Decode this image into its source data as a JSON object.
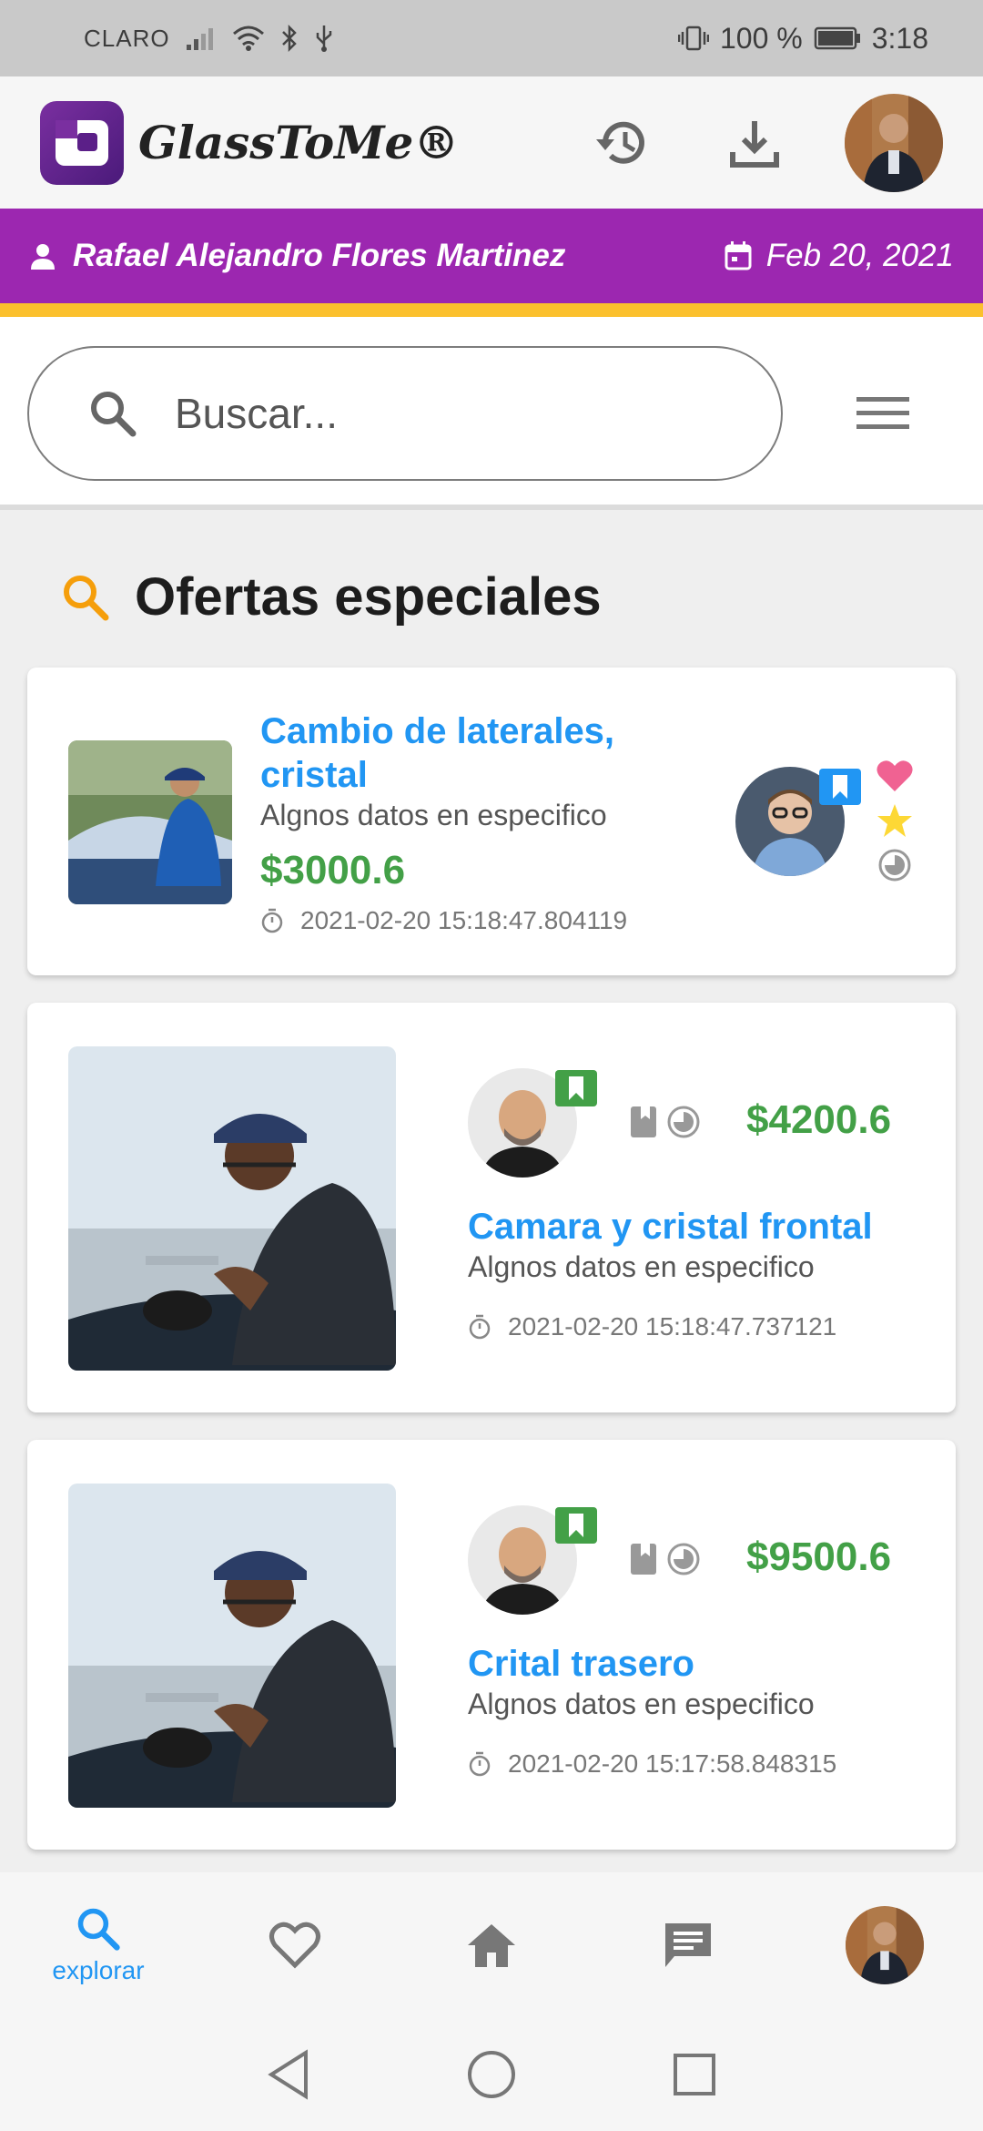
{
  "status_bar": {
    "carrier": "CLARO",
    "battery": "100 %",
    "time": "3:18"
  },
  "app": {
    "name": "GlassToMe®"
  },
  "user_bar": {
    "name": "Rafael Alejandro Flores Martinez",
    "date": "Feb 20, 2021"
  },
  "search": {
    "placeholder": "Buscar..."
  },
  "section": {
    "title": "Ofertas especiales"
  },
  "offers": [
    {
      "title": "Cambio de laterales, cristal",
      "subtitle": "Algnos datos en especifico",
      "price": "$3000.6",
      "timestamp": "2021-02-20 15:18:47.804119"
    },
    {
      "title": "Camara y cristal frontal",
      "subtitle": "Algnos datos en especifico",
      "price": "$4200.6",
      "timestamp": "2021-02-20 15:18:47.737121"
    },
    {
      "title": "Crital trasero",
      "subtitle": "Algnos datos en especifico",
      "price": "$9500.6",
      "timestamp": "2021-02-20 15:17:58.848315"
    }
  ],
  "bottom_nav": {
    "explore_label": "explorar"
  },
  "colors": {
    "purple": "#9c27b0",
    "yellow": "#fbc02d",
    "blue": "#2196f3",
    "green": "#43a047",
    "pink": "#f06292"
  }
}
